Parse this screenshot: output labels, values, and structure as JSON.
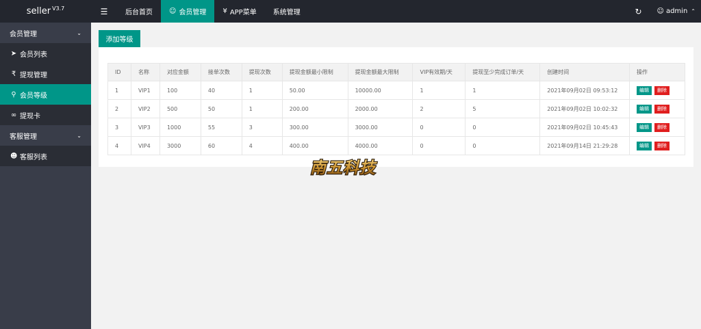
{
  "app": {
    "name": "seller",
    "version": "V3.7"
  },
  "topnav": {
    "menu_icon": "menu-icon",
    "items": [
      {
        "label": "后台首页",
        "icon": ""
      },
      {
        "label": "会员管理",
        "icon": "user-icon"
      },
      {
        "label": "APP菜单",
        "icon": "yen-icon"
      },
      {
        "label": "系统管理",
        "icon": ""
      }
    ],
    "active_index": 1
  },
  "topright": {
    "refresh_icon": "refresh-icon",
    "user": "admin"
  },
  "sidebar": {
    "groups": [
      {
        "label": "会员管理",
        "items": [
          {
            "label": "会员列表",
            "icon": "rocket-icon"
          },
          {
            "label": "提现管理",
            "icon": "rupee-icon"
          },
          {
            "label": "会员等级",
            "icon": "key-icon"
          },
          {
            "label": "提现卡",
            "icon": "link-icon"
          }
        ]
      },
      {
        "label": "客服管理",
        "items": [
          {
            "label": "客服列表",
            "icon": "users-icon"
          }
        ]
      }
    ],
    "active_item": "会员等级"
  },
  "main": {
    "add_button": "添加等级",
    "table": {
      "headers": [
        "ID",
        "名称",
        "对应金额",
        "接单次数",
        "提现次数",
        "提现金额最小限制",
        "提现金额最大限制",
        "VIP有效期/天",
        "提现至少完成订单/天",
        "创建时间",
        "操作"
      ],
      "rows": [
        [
          "1",
          "VIP1",
          "100",
          "40",
          "1",
          "50.00",
          "10000.00",
          "1",
          "1",
          "2021年09月02日 09:53:12"
        ],
        [
          "2",
          "VIP2",
          "500",
          "50",
          "1",
          "200.00",
          "2000.00",
          "2",
          "5",
          "2021年09月02日 10:02:32"
        ],
        [
          "3",
          "VIP3",
          "1000",
          "55",
          "3",
          "300.00",
          "3000.00",
          "0",
          "0",
          "2021年09月02日 10:45:43"
        ],
        [
          "4",
          "VIP4",
          "3000",
          "60",
          "4",
          "400.00",
          "4000.00",
          "0",
          "0",
          "2021年09月14日 21:29:28"
        ]
      ],
      "edit_label": "编辑",
      "delete_label": "删除"
    }
  },
  "watermark": {
    "text": "南五科技"
  },
  "colors": {
    "header": "#23262e",
    "sidebar": "#393d49",
    "accent": "#009688",
    "danger": "#e01e1e"
  }
}
